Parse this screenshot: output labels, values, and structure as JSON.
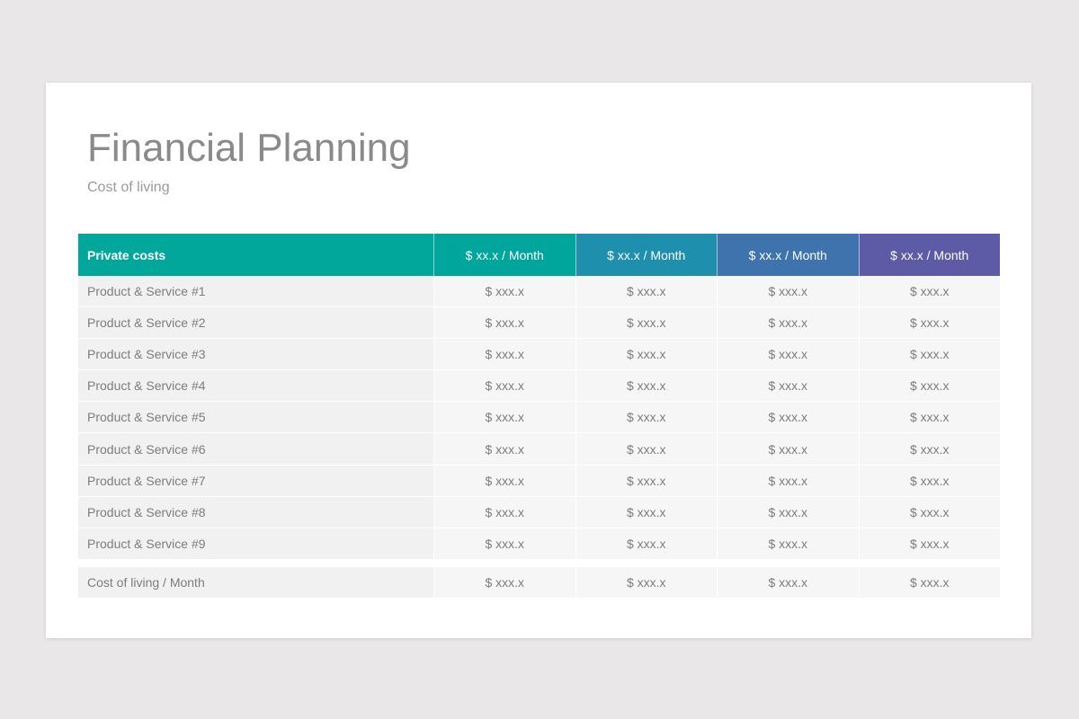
{
  "title": "Financial Planning",
  "subtitle": "Cost of living",
  "colors": {
    "header_col_0": "#00a79a",
    "header_col_1": "#00a59b",
    "header_col_2": "#1e8fad",
    "header_col_3": "#3f73ad",
    "header_col_4": "#5d5aa6"
  },
  "table": {
    "headers": [
      "Private costs",
      "$ xx.x / Month",
      "$ xx.x / Month",
      "$ xx.x / Month",
      "$ xx.x / Month"
    ],
    "rows": [
      [
        "Product & Service #1",
        "$ xxx.x",
        "$ xxx.x",
        "$ xxx.x",
        "$ xxx.x"
      ],
      [
        "Product & Service #2",
        "$ xxx.x",
        "$ xxx.x",
        "$ xxx.x",
        "$ xxx.x"
      ],
      [
        "Product & Service #3",
        "$ xxx.x",
        "$ xxx.x",
        "$ xxx.x",
        "$ xxx.x"
      ],
      [
        "Product & Service #4",
        "$ xxx.x",
        "$ xxx.x",
        "$ xxx.x",
        "$ xxx.x"
      ],
      [
        "Product & Service #5",
        "$ xxx.x",
        "$ xxx.x",
        "$ xxx.x",
        "$ xxx.x"
      ],
      [
        "Product & Service #6",
        "$ xxx.x",
        "$ xxx.x",
        "$ xxx.x",
        "$ xxx.x"
      ],
      [
        "Product & Service #7",
        "$ xxx.x",
        "$ xxx.x",
        "$ xxx.x",
        "$ xxx.x"
      ],
      [
        "Product & Service #8",
        "$ xxx.x",
        "$ xxx.x",
        "$ xxx.x",
        "$ xxx.x"
      ],
      [
        "Product & Service #9",
        "$ xxx.x",
        "$ xxx.x",
        "$ xxx.x",
        "$ xxx.x"
      ]
    ],
    "total": [
      "Cost of living / Month",
      "$ xxx.x",
      "$ xxx.x",
      "$ xxx.x",
      "$ xxx.x"
    ]
  }
}
